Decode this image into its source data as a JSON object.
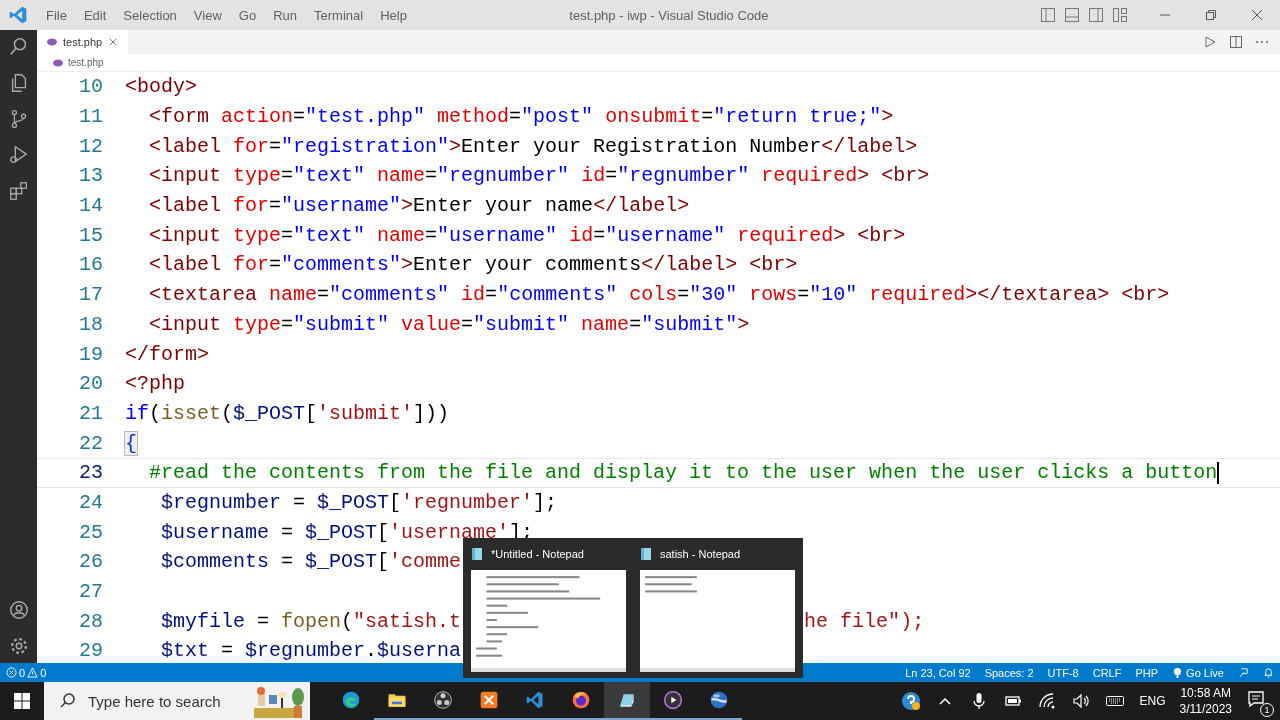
{
  "window": {
    "title": "test.php - iwp - Visual Studio Code"
  },
  "menu": [
    "File",
    "Edit",
    "Selection",
    "View",
    "Go",
    "Run",
    "Terminal",
    "Help"
  ],
  "activity_bar": [
    {
      "kind": "search",
      "selected": false
    },
    {
      "kind": "explorer",
      "selected": false
    },
    {
      "kind": "git",
      "selected": false
    },
    {
      "kind": "debug",
      "selected": false
    },
    {
      "kind": "extensions",
      "selected": false
    }
  ],
  "activity_bar_bottom": [
    {
      "kind": "account"
    },
    {
      "kind": "settings"
    }
  ],
  "tabs": [
    {
      "label": "test.php",
      "selected": true
    }
  ],
  "breadcrumb": [
    "test.php"
  ],
  "editor": {
    "lines": [
      {
        "number": "10",
        "current": false,
        "tokens": [
          {
            "kind": "tag",
            "text": "<body>"
          }
        ]
      },
      {
        "number": "11",
        "current": false,
        "tokens": [
          {
            "kind": "tag",
            "text": "  <form"
          },
          {
            "kind": "attr",
            "text": " action"
          },
          {
            "kind": "text",
            "text": "="
          },
          {
            "kind": "string",
            "text": "\"test.php\""
          },
          {
            "kind": "attr",
            "text": " method"
          },
          {
            "kind": "text",
            "text": "="
          },
          {
            "kind": "string",
            "text": "\"post\""
          },
          {
            "kind": "attr",
            "text": " onsubmit"
          },
          {
            "kind": "text",
            "text": "="
          },
          {
            "kind": "string",
            "text": "\"return true;\""
          },
          {
            "kind": "tag",
            "text": ">"
          }
        ]
      },
      {
        "number": "12",
        "current": false,
        "tokens": [
          {
            "kind": "tag",
            "text": "  <label"
          },
          {
            "kind": "attr",
            "text": " for"
          },
          {
            "kind": "text",
            "text": "="
          },
          {
            "kind": "string",
            "text": "\"registration\""
          },
          {
            "kind": "tag",
            "text": ">"
          },
          {
            "kind": "text",
            "text": "Enter your Registration Number"
          },
          {
            "kind": "tag",
            "text": "</label>"
          }
        ]
      },
      {
        "number": "13",
        "current": false,
        "tokens": [
          {
            "kind": "tag",
            "text": "  <input"
          },
          {
            "kind": "attr",
            "text": " type"
          },
          {
            "kind": "text",
            "text": "="
          },
          {
            "kind": "string",
            "text": "\"text\""
          },
          {
            "kind": "attr",
            "text": " name"
          },
          {
            "kind": "text",
            "text": "="
          },
          {
            "kind": "string",
            "text": "\"regnumber\""
          },
          {
            "kind": "attr",
            "text": " id"
          },
          {
            "kind": "text",
            "text": "="
          },
          {
            "kind": "string",
            "text": "\"regnumber\""
          },
          {
            "kind": "attr",
            "text": " required"
          },
          {
            "kind": "tag",
            "text": ">"
          },
          {
            "kind": "tag",
            "text": " <br>"
          }
        ]
      },
      {
        "number": "14",
        "current": false,
        "tokens": [
          {
            "kind": "tag",
            "text": "  <label"
          },
          {
            "kind": "attr",
            "text": " for"
          },
          {
            "kind": "text",
            "text": "="
          },
          {
            "kind": "string",
            "text": "\"username\""
          },
          {
            "kind": "tag",
            "text": ">"
          },
          {
            "kind": "text",
            "text": "Enter your name"
          },
          {
            "kind": "tag",
            "text": "</label>"
          }
        ]
      },
      {
        "number": "15",
        "current": false,
        "tokens": [
          {
            "kind": "tag",
            "text": "  <input"
          },
          {
            "kind": "attr",
            "text": " type"
          },
          {
            "kind": "text",
            "text": "="
          },
          {
            "kind": "string",
            "text": "\"text\""
          },
          {
            "kind": "attr",
            "text": " name"
          },
          {
            "kind": "text",
            "text": "="
          },
          {
            "kind": "string",
            "text": "\"username\""
          },
          {
            "kind": "attr",
            "text": " id"
          },
          {
            "kind": "text",
            "text": "="
          },
          {
            "kind": "string",
            "text": "\"username\""
          },
          {
            "kind": "attr",
            "text": " required"
          },
          {
            "kind": "tag",
            "text": ">"
          },
          {
            "kind": "tag",
            "text": " <br>"
          }
        ]
      },
      {
        "number": "16",
        "current": false,
        "tokens": [
          {
            "kind": "tag",
            "text": "  <label"
          },
          {
            "kind": "attr",
            "text": " for"
          },
          {
            "kind": "text",
            "text": "="
          },
          {
            "kind": "string",
            "text": "\"comments\""
          },
          {
            "kind": "tag",
            "text": ">"
          },
          {
            "kind": "text",
            "text": "Enter your comments"
          },
          {
            "kind": "tag",
            "text": "</label> <br>"
          }
        ]
      },
      {
        "number": "17",
        "current": false,
        "tokens": [
          {
            "kind": "tag",
            "text": "  <textarea"
          },
          {
            "kind": "attr",
            "text": " name"
          },
          {
            "kind": "text",
            "text": "="
          },
          {
            "kind": "string",
            "text": "\"comments\""
          },
          {
            "kind": "attr",
            "text": " id"
          },
          {
            "kind": "text",
            "text": "="
          },
          {
            "kind": "string",
            "text": "\"comments\""
          },
          {
            "kind": "attr",
            "text": " cols"
          },
          {
            "kind": "text",
            "text": "="
          },
          {
            "kind": "string",
            "text": "\"30\""
          },
          {
            "kind": "attr",
            "text": " rows"
          },
          {
            "kind": "text",
            "text": "="
          },
          {
            "kind": "string",
            "text": "\"10\""
          },
          {
            "kind": "attr",
            "text": " required"
          },
          {
            "kind": "tag",
            "text": "></textarea> <br>"
          }
        ]
      },
      {
        "number": "18",
        "current": false,
        "tokens": [
          {
            "kind": "tag",
            "text": "  <input"
          },
          {
            "kind": "attr",
            "text": " type"
          },
          {
            "kind": "text",
            "text": "="
          },
          {
            "kind": "string",
            "text": "\"submit\""
          },
          {
            "kind": "attr",
            "text": " value"
          },
          {
            "kind": "text",
            "text": "="
          },
          {
            "kind": "string",
            "text": "\"submit\""
          },
          {
            "kind": "attr",
            "text": " name"
          },
          {
            "kind": "text",
            "text": "="
          },
          {
            "kind": "string",
            "text": "\"submit\""
          },
          {
            "kind": "tag",
            "text": ">"
          }
        ]
      },
      {
        "number": "19",
        "current": false,
        "tokens": [
          {
            "kind": "tag",
            "text": "</form>"
          }
        ]
      },
      {
        "number": "20",
        "current": false,
        "tokens": [
          {
            "kind": "tag",
            "text": "<?php"
          }
        ]
      },
      {
        "number": "21",
        "current": false,
        "tokens": [
          {
            "kind": "keyword",
            "text": "if"
          },
          {
            "kind": "text",
            "text": "("
          },
          {
            "kind": "func",
            "text": "isset"
          },
          {
            "kind": "text",
            "text": "("
          },
          {
            "kind": "var",
            "text": "$_POST"
          },
          {
            "kind": "text",
            "text": "["
          },
          {
            "kind": "pstring",
            "text": "'submit'"
          },
          {
            "kind": "text",
            "text": "]))"
          }
        ]
      },
      {
        "number": "22",
        "current": false,
        "tokens": [
          {
            "kind": "bracket",
            "text": "{"
          }
        ]
      },
      {
        "number": "23",
        "current": true,
        "tokens": [
          {
            "kind": "comment",
            "text": "  #read the contents from the file and display it to the user when the user clicks a button"
          }
        ]
      },
      {
        "number": "24",
        "current": false,
        "tokens": [
          {
            "kind": "var",
            "text": "   $regnumber"
          },
          {
            "kind": "text",
            "text": " = "
          },
          {
            "kind": "var",
            "text": "$_POST"
          },
          {
            "kind": "text",
            "text": "["
          },
          {
            "kind": "pstring",
            "text": "'regnumber'"
          },
          {
            "kind": "text",
            "text": "];"
          }
        ]
      },
      {
        "number": "25",
        "current": false,
        "tokens": [
          {
            "kind": "var",
            "text": "   $username"
          },
          {
            "kind": "text",
            "text": " = "
          },
          {
            "kind": "var",
            "text": "$_POST"
          },
          {
            "kind": "text",
            "text": "["
          },
          {
            "kind": "pstring",
            "text": "'username'"
          },
          {
            "kind": "text",
            "text": "];"
          }
        ]
      },
      {
        "number": "26",
        "current": false,
        "tokens": [
          {
            "kind": "var",
            "text": "   $comments"
          },
          {
            "kind": "text",
            "text": " = "
          },
          {
            "kind": "var",
            "text": "$_POST"
          },
          {
            "kind": "text",
            "text": "["
          },
          {
            "kind": "pstring",
            "text": "'comme"
          }
        ]
      },
      {
        "number": "27",
        "current": false
      },
      {
        "number": "28",
        "current": false,
        "tokens": [
          {
            "kind": "var",
            "text": "   $myfile"
          },
          {
            "kind": "text",
            "text": " = "
          },
          {
            "kind": "func",
            "text": "fopen"
          },
          {
            "kind": "text",
            "text": "("
          },
          {
            "kind": "pstring",
            "text": "\"satish.t"
          },
          {
            "kind": "resume",
            "text": "he file\");"
          }
        ]
      },
      {
        "number": "29",
        "current": false,
        "tokens": [
          {
            "kind": "var",
            "text": "   $txt"
          },
          {
            "kind": "text",
            "text": " = "
          },
          {
            "kind": "var",
            "text": "$regnumber"
          },
          {
            "kind": "text",
            "text": "."
          },
          {
            "kind": "var",
            "text": "$userna"
          }
        ]
      }
    ]
  },
  "status_bar": {
    "errors": "0",
    "warnings": "0",
    "right": [
      {
        "kind": "text",
        "text": "Ln 23, Col 92"
      },
      {
        "kind": "text",
        "text": "Spaces: 2"
      },
      {
        "kind": "text",
        "text": "UTF-8"
      },
      {
        "kind": "text",
        "text": "CRLF"
      },
      {
        "kind": "text",
        "text": "PHP"
      },
      {
        "kind": "live",
        "text": "Go Live"
      }
    ]
  },
  "taskbar_preview": [
    {
      "title": "*Untitled - Notepad"
    },
    {
      "title": "satish - Notepad"
    }
  ],
  "taskbar": {
    "search": {
      "placeholder": "Type here to search"
    },
    "apps": [
      {
        "kind": "edge",
        "running": false,
        "selected": false
      },
      {
        "kind": "folder",
        "running": true,
        "selected": false
      },
      {
        "kind": "obs",
        "running": true,
        "selected": false
      },
      {
        "kind": "xampp",
        "running": true,
        "selected": false
      },
      {
        "kind": "vscode",
        "running": true,
        "selected": false
      },
      {
        "kind": "firefox",
        "running": true,
        "selected": false
      },
      {
        "kind": "notepad",
        "running": true,
        "selected": true
      },
      {
        "kind": "player",
        "running": true,
        "selected": false
      },
      {
        "kind": "globe",
        "running": true,
        "selected": false
      }
    ],
    "language": "ENG",
    "time": "10:58 AM",
    "date": "3/11/2023",
    "notifications": "1"
  }
}
